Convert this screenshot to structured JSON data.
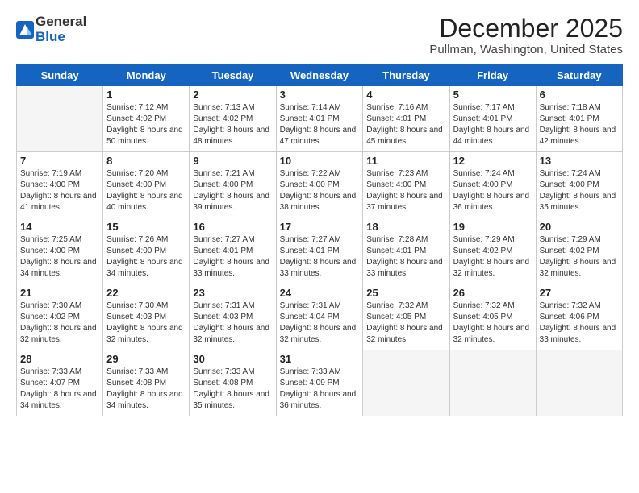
{
  "logo": {
    "line1": "General",
    "line2": "Blue"
  },
  "title": "December 2025",
  "subtitle": "Pullman, Washington, United States",
  "weekdays": [
    "Sunday",
    "Monday",
    "Tuesday",
    "Wednesday",
    "Thursday",
    "Friday",
    "Saturday"
  ],
  "weeks": [
    [
      {
        "day": "",
        "empty": true
      },
      {
        "day": "1",
        "sunrise": "7:12 AM",
        "sunset": "4:02 PM",
        "daylight": "8 hours and 50 minutes."
      },
      {
        "day": "2",
        "sunrise": "7:13 AM",
        "sunset": "4:02 PM",
        "daylight": "8 hours and 48 minutes."
      },
      {
        "day": "3",
        "sunrise": "7:14 AM",
        "sunset": "4:01 PM",
        "daylight": "8 hours and 47 minutes."
      },
      {
        "day": "4",
        "sunrise": "7:16 AM",
        "sunset": "4:01 PM",
        "daylight": "8 hours and 45 minutes."
      },
      {
        "day": "5",
        "sunrise": "7:17 AM",
        "sunset": "4:01 PM",
        "daylight": "8 hours and 44 minutes."
      },
      {
        "day": "6",
        "sunrise": "7:18 AM",
        "sunset": "4:01 PM",
        "daylight": "8 hours and 42 minutes."
      }
    ],
    [
      {
        "day": "7",
        "sunrise": "7:19 AM",
        "sunset": "4:00 PM",
        "daylight": "8 hours and 41 minutes."
      },
      {
        "day": "8",
        "sunrise": "7:20 AM",
        "sunset": "4:00 PM",
        "daylight": "8 hours and 40 minutes."
      },
      {
        "day": "9",
        "sunrise": "7:21 AM",
        "sunset": "4:00 PM",
        "daylight": "8 hours and 39 minutes."
      },
      {
        "day": "10",
        "sunrise": "7:22 AM",
        "sunset": "4:00 PM",
        "daylight": "8 hours and 38 minutes."
      },
      {
        "day": "11",
        "sunrise": "7:23 AM",
        "sunset": "4:00 PM",
        "daylight": "8 hours and 37 minutes."
      },
      {
        "day": "12",
        "sunrise": "7:24 AM",
        "sunset": "4:00 PM",
        "daylight": "8 hours and 36 minutes."
      },
      {
        "day": "13",
        "sunrise": "7:24 AM",
        "sunset": "4:00 PM",
        "daylight": "8 hours and 35 minutes."
      }
    ],
    [
      {
        "day": "14",
        "sunrise": "7:25 AM",
        "sunset": "4:00 PM",
        "daylight": "8 hours and 34 minutes."
      },
      {
        "day": "15",
        "sunrise": "7:26 AM",
        "sunset": "4:00 PM",
        "daylight": "8 hours and 34 minutes."
      },
      {
        "day": "16",
        "sunrise": "7:27 AM",
        "sunset": "4:01 PM",
        "daylight": "8 hours and 33 minutes."
      },
      {
        "day": "17",
        "sunrise": "7:27 AM",
        "sunset": "4:01 PM",
        "daylight": "8 hours and 33 minutes."
      },
      {
        "day": "18",
        "sunrise": "7:28 AM",
        "sunset": "4:01 PM",
        "daylight": "8 hours and 33 minutes."
      },
      {
        "day": "19",
        "sunrise": "7:29 AM",
        "sunset": "4:02 PM",
        "daylight": "8 hours and 32 minutes."
      },
      {
        "day": "20",
        "sunrise": "7:29 AM",
        "sunset": "4:02 PM",
        "daylight": "8 hours and 32 minutes."
      }
    ],
    [
      {
        "day": "21",
        "sunrise": "7:30 AM",
        "sunset": "4:02 PM",
        "daylight": "8 hours and 32 minutes."
      },
      {
        "day": "22",
        "sunrise": "7:30 AM",
        "sunset": "4:03 PM",
        "daylight": "8 hours and 32 minutes."
      },
      {
        "day": "23",
        "sunrise": "7:31 AM",
        "sunset": "4:03 PM",
        "daylight": "8 hours and 32 minutes."
      },
      {
        "day": "24",
        "sunrise": "7:31 AM",
        "sunset": "4:04 PM",
        "daylight": "8 hours and 32 minutes."
      },
      {
        "day": "25",
        "sunrise": "7:32 AM",
        "sunset": "4:05 PM",
        "daylight": "8 hours and 32 minutes."
      },
      {
        "day": "26",
        "sunrise": "7:32 AM",
        "sunset": "4:05 PM",
        "daylight": "8 hours and 32 minutes."
      },
      {
        "day": "27",
        "sunrise": "7:32 AM",
        "sunset": "4:06 PM",
        "daylight": "8 hours and 33 minutes."
      }
    ],
    [
      {
        "day": "28",
        "sunrise": "7:33 AM",
        "sunset": "4:07 PM",
        "daylight": "8 hours and 34 minutes."
      },
      {
        "day": "29",
        "sunrise": "7:33 AM",
        "sunset": "4:08 PM",
        "daylight": "8 hours and 34 minutes."
      },
      {
        "day": "30",
        "sunrise": "7:33 AM",
        "sunset": "4:08 PM",
        "daylight": "8 hours and 35 minutes."
      },
      {
        "day": "31",
        "sunrise": "7:33 AM",
        "sunset": "4:09 PM",
        "daylight": "8 hours and 36 minutes."
      },
      {
        "day": "",
        "empty": true
      },
      {
        "day": "",
        "empty": true
      },
      {
        "day": "",
        "empty": true
      }
    ]
  ]
}
